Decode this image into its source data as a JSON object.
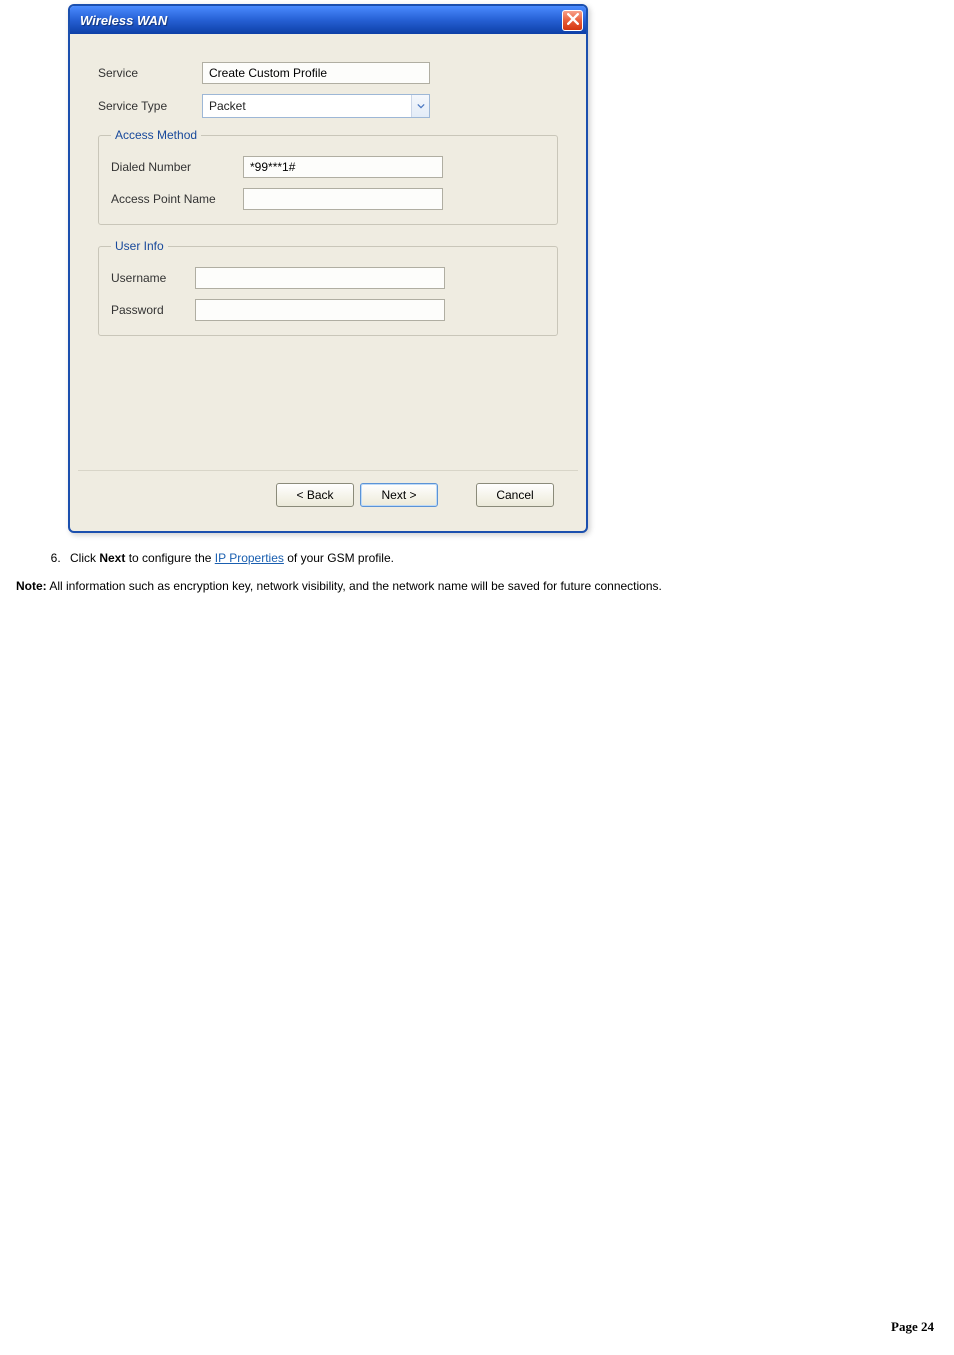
{
  "dialog": {
    "title": "Wireless WAN",
    "service_label": "Service",
    "service_value": "Create Custom Profile",
    "service_type_label": "Service Type",
    "service_type_value": "Packet",
    "access_method": {
      "legend": "Access Method",
      "dialed_number_label": "Dialed Number",
      "dialed_number_value": "*99***1#",
      "apn_label": "Access Point Name",
      "apn_value": ""
    },
    "user_info": {
      "legend": "User Info",
      "username_label": "Username",
      "username_value": "",
      "password_label": "Password",
      "password_value": ""
    },
    "buttons": {
      "back": "< Back",
      "next": "Next >",
      "cancel": "Cancel"
    }
  },
  "doc": {
    "list_start": 6,
    "step_prefix": "Click ",
    "step_button": "Next",
    "step_mid": " to configure the ",
    "step_link": "IP Properties",
    "step_suffix": " of your GSM profile.",
    "note_bold": "Note:",
    "note_text": " All information such as encryption key, network visibility, and the network name will be saved for future connections."
  },
  "footer": {
    "label": "Page 24"
  }
}
